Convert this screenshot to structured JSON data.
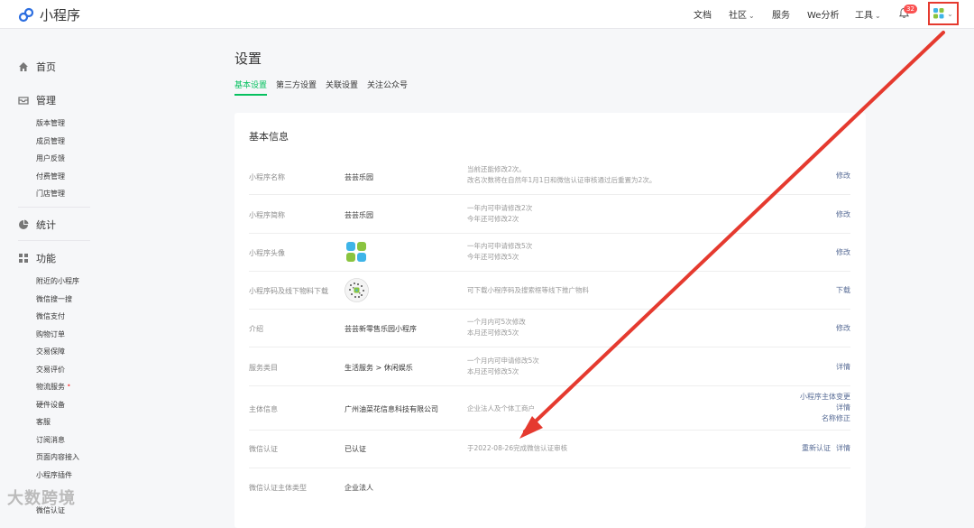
{
  "header": {
    "app_name": "小程序",
    "nav": [
      "文档",
      "社区",
      "服务",
      "We分析",
      "工具"
    ],
    "notification_count": "32"
  },
  "sidebar": {
    "home": "首页",
    "manage": "管理",
    "manage_items": [
      "版本管理",
      "成员管理",
      "用户反馈",
      "付费管理",
      "门店管理"
    ],
    "stats": "统计",
    "features": "功能",
    "feature_items": [
      "附近的小程序",
      "微信搜一搜",
      "微信支付",
      "购物订单",
      "交易保障",
      "交易评价",
      "物流服务",
      "硬件设备",
      "客服",
      "订阅消息",
      "页面内容接入",
      "小程序插件",
      "",
      "微信认证"
    ],
    "logistics_dot": "•"
  },
  "page": {
    "title": "设置",
    "tabs": [
      "基本设置",
      "第三方设置",
      "关联设置",
      "关注公众号"
    ]
  },
  "card": {
    "title": "基本信息",
    "rows": [
      {
        "label": "小程序名称",
        "value": "芸芸乐园",
        "desc": [
          "当前还能修改2次。",
          "改名次数将在自然年1月1日和微信认证审核通过后重置为2次。"
        ],
        "actions": [
          "修改"
        ]
      },
      {
        "label": "小程序简称",
        "value": "芸芸乐园",
        "desc": [
          "一年内可申请修改2次",
          "今年还可修改2次"
        ],
        "actions": [
          "修改"
        ]
      },
      {
        "label": "小程序头像",
        "value": "",
        "desc": [
          "一年内可申请修改5次",
          "今年还可修改5次"
        ],
        "actions": [
          "修改"
        ]
      },
      {
        "label": "小程序码及线下物料下载",
        "value": "",
        "desc": [
          "可下载小程序码及搜索框等线下推广物料"
        ],
        "actions": [
          "下载"
        ]
      },
      {
        "label": "介绍",
        "value": "芸芸新零售乐园小程序",
        "desc": [
          "一个月内可5次修改",
          "本月还可修改5次"
        ],
        "actions": [
          "修改"
        ]
      },
      {
        "label": "服务类目",
        "value": "生活服务 > 休闲娱乐",
        "desc": [
          "一个月内可申请修改5次",
          "本月还可修改5次"
        ],
        "actions": [
          "详情"
        ]
      },
      {
        "label": "主体信息",
        "value": "广州油菜花信息科技有限公司",
        "desc": [
          "企业法人及个体工商户"
        ],
        "actions": [
          "小程序主体变更",
          "详情",
          "名称修正"
        ]
      },
      {
        "label": "微信认证",
        "value": "已认证",
        "desc": [
          "于2022-08-26完成微信认证审核"
        ],
        "actions": [
          "重新认证",
          "详情"
        ]
      },
      {
        "label": "微信认证主体类型",
        "value": "企业法人",
        "desc": [],
        "actions": []
      }
    ]
  },
  "watermark": "大数跨境",
  "colors": {
    "accent": "#07c160",
    "link": "#576b95",
    "highlight": "#e53a2f"
  }
}
